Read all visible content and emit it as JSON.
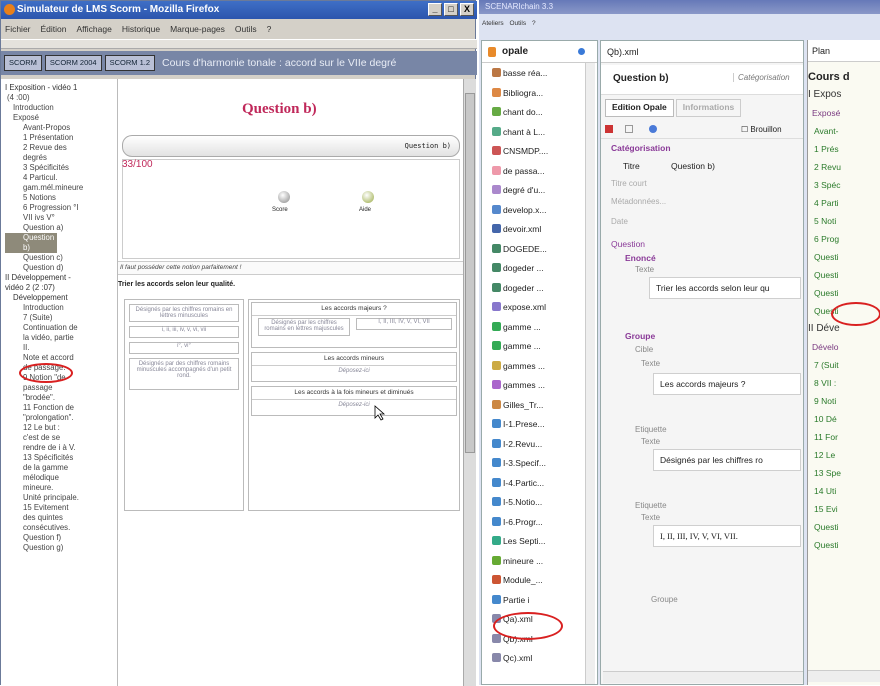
{
  "firefox": {
    "title": "Simulateur de LMS Scorm - Mozilla Firefox",
    "window_buttons": [
      "_",
      "□",
      "X"
    ],
    "menu": [
      "Fichier",
      "Édition",
      "Affichage",
      "Historique",
      "Marque-pages",
      "Outils",
      "?"
    ],
    "tabs": [
      "SCORM",
      "SCORM 2004",
      "SCORM 1.2"
    ],
    "page_title": "Cours d'harmonie tonale : accord sur le VIIe degré",
    "sidebar": [
      "I Exposition - vidéo 1",
      "(4 :00)",
      "Introduction",
      "Exposé",
      "Avant-Propos",
      "1 Présentation",
      "2 Revue des",
      "degrés",
      "3 Spécificités",
      "4 Particul.",
      "gam.mél.mineure",
      "5 Notions",
      "6 Progression °I",
      "VII ivs V°",
      "Question a)",
      "Question b)",
      "Question c)",
      "Question d)",
      "II Développement -",
      "vidéo 2 (2 :07)",
      "Développement",
      "Introduction",
      "7 (Suite)",
      "Continuation de",
      "la vidéo, partie",
      "II.",
      "Note et accord",
      "de passage.",
      "9 Notion \"de",
      "passage",
      "\"brodée\".",
      "11 Fonction de",
      "\"prolongation\".",
      "12 Le but :",
      "c'est de se",
      "rendre de i à V.",
      "13 Spécificités",
      "de la gamme",
      "mélodique",
      "mineure.",
      "Unité principale.",
      "15 Evitement",
      "des quintes",
      "consécutives.",
      "Question f)",
      "Question g)"
    ],
    "content": {
      "question_title": "Question b)",
      "bar_label": "Question b)",
      "score_text": "33/100",
      "score_label": "Score",
      "help_label": "Aide",
      "feedback": "Il faut posséder cette notion parfaitement !",
      "instruction": "Trier les accords selon leur qualité.",
      "labels": [
        "Désignés par les chiffres romains en lettres minuscules",
        "i, ii, iii, iv, v, vi, vii",
        "i°, vi°",
        "Désignés par des chiffres romains minuscules accompagnés d'un petit rond."
      ],
      "label_major_drag": "Désignés par les chiffres romains en lettres majuscules",
      "label_major_vals": "I, II, III, IV, V, VI, VII",
      "groups": [
        {
          "title": "Les accords majeurs ?",
          "drop": ""
        },
        {
          "title": "Les accords mineurs",
          "drop": "Déposez-ici"
        },
        {
          "title": "Les accords à la fois mineurs et diminués",
          "drop": "Déposez-ici"
        }
      ]
    }
  },
  "scenari": {
    "title": "SCENARIchain 3.3",
    "menu": [
      "Ateliers",
      "Outils",
      "?"
    ],
    "tree_header": "opale",
    "tree": [
      "basse réa...",
      "Bibliogra...",
      "chant do...",
      "chant à L...",
      "CNSMDP....",
      "de passa...",
      "degré d'u...",
      "develop.x...",
      "devoir.xml",
      "DOGEDE...",
      "dogeder ...",
      "dogeder ...",
      "expose.xml",
      "gamme ...",
      "gamme ...",
      "gammes ...",
      "gammes ...",
      "Gilles_Tr...",
      "I-1.Prese...",
      "I-2.Revu...",
      "I-3.Specif...",
      "I-4.Partic...",
      "I-5.Notio...",
      "I-6.Progr...",
      "Les Septi...",
      "mineure ...",
      "Module_...",
      "Partie i",
      "Qa).xml",
      "Qb).xml",
      "Qc).xml"
    ],
    "editor": {
      "tab": "Qb).xml",
      "heading": "Question b)",
      "heading_link": "Catégorisation",
      "subtab1": "Edition Opale",
      "subtab2": "Informations",
      "brouillon": "Brouillon",
      "section": "Catégorisation",
      "titre_label": "Titre",
      "titre_value": "Question b)",
      "titre_court": "Titre court",
      "metadonnees": "Métadonnées...",
      "date": "Date",
      "question": "Question",
      "enonce": "Enoncé",
      "texte": "Texte",
      "enonce_text": "Trier les accords selon leur qu",
      "groupe": "Groupe",
      "cible": "Cible",
      "cible_text": "Les accords majeurs ?",
      "etiquette": "Etiquette",
      "etiq1_text": "Désignés par les chiffres ro",
      "etiq2_text": "I, II, III, IV, V, VI, VII.",
      "groupe_bottom": "Groupe"
    },
    "plan": {
      "header": "Plan",
      "rows": [
        "Cours d",
        "I Expos",
        "Exposé",
        "Avant-",
        "1 Prés",
        "2 Revu",
        "3 Spéc",
        "4 Parti",
        "5 Noti",
        "6 Prog",
        "Questi",
        "Questi",
        "Questi",
        "Questi",
        "II Déve",
        "Dévelo",
        "7 (Suit",
        "8 VII :",
        "9 Noti",
        "10 Dé",
        "11 For",
        "12 Le",
        "13 Spe",
        "14 Uti",
        "15 Evi",
        "Questi",
        "Questi"
      ]
    }
  }
}
